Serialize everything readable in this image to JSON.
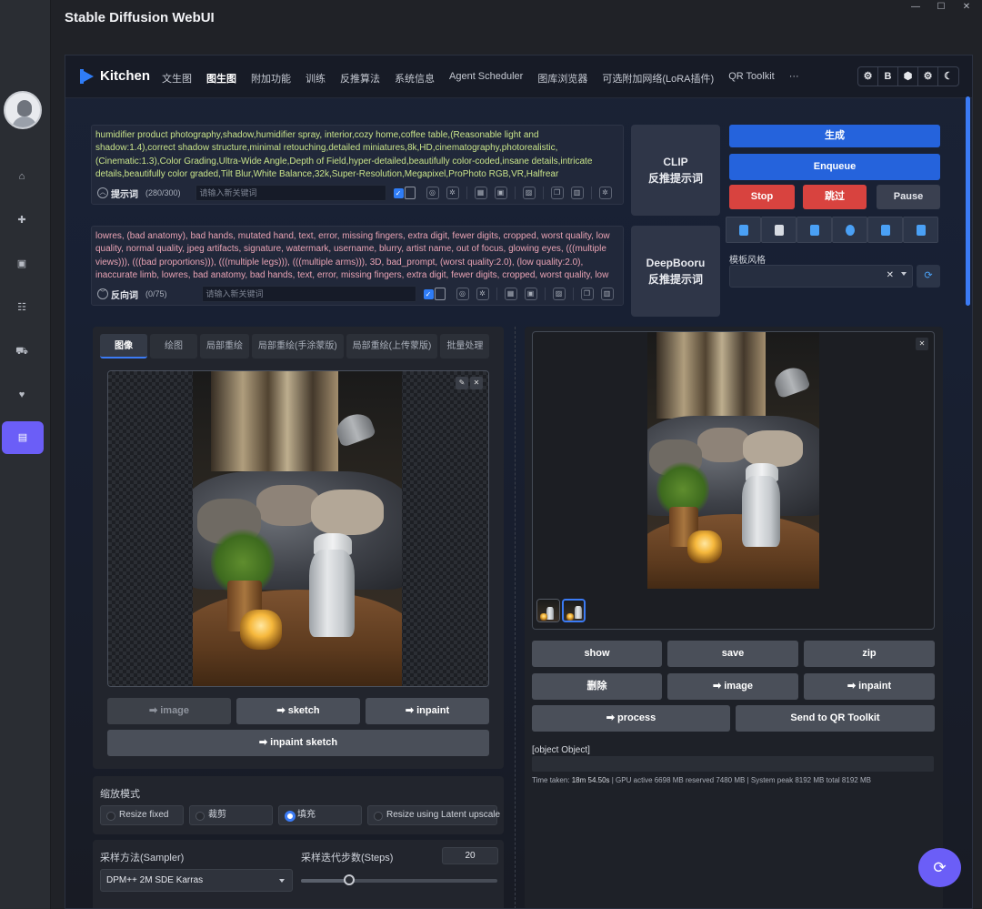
{
  "window": {
    "title": "Stable Diffusion WebUI",
    "controls": [
      "—",
      "☐",
      "✕"
    ]
  },
  "rail": {
    "items": [
      "⌂",
      "✚",
      "▣",
      "☷",
      "⛟",
      "♥",
      "▤"
    ]
  },
  "app": {
    "logo": "Kitchen",
    "tabs": [
      "文生图",
      "图生图",
      "附加功能",
      "训练",
      "反推算法",
      "系统信息",
      "Agent Scheduler",
      "图库浏览器",
      "可选附加网络(LoRA插件)",
      "QR Toolkit",
      "···"
    ],
    "active_tab": "图生图",
    "icons": [
      "⚙",
      "B",
      "⬢",
      "⚙",
      "☾"
    ]
  },
  "prompt": {
    "text": "humidifier product photography,shadow,humidifier spray, interior,cozy home,coffee table,(Reasonable light and shadow:1.4),correct shadow structure,minimal retouching,detailed miniatures,8k,HD,cinematography,photorealistic,(Cinematic:1.3),Color Grading,Ultra-Wide Angle,Depth of Field,hyper-detailed,beautifully color-coded,insane details,intricate details,beautifully color graded,Tilt Blur,White Balance,32k,Super-Resolution,Megapixel,ProPhoto RGB,VR,Halfrear",
    "label": "提示词",
    "count": "(280/300)",
    "keyword_placeholder": "请输入新关键词"
  },
  "negative": {
    "text": "lowres, (bad anatomy), bad hands, mutated hand, text, error, missing fingers, extra digit, fewer digits, cropped, worst quality, low quality, normal quality, jpeg artifacts, signature, watermark, username, blurry, artist name, out of focus, glowing eyes, (((multiple views))), (((bad proportions))), (((multiple legs))), (((multiple arms))), 3D, bad_prompt, (worst quality:2.0), (low quality:2.0), inaccurate limb, lowres, bad anatomy, bad hands, text, error, missing fingers, extra digit, fewer digits, cropped, worst quality, low",
    "label": "反向词",
    "count": "(0/75)",
    "keyword_placeholder": "请输入新关键词"
  },
  "interrogate": {
    "clip_line1": "CLIP",
    "clip_line2": "反推提示词",
    "deepbooru_line1": "DeepBooru",
    "deepbooru_line2": "反推提示词"
  },
  "actions": {
    "generate": "生成",
    "enqueue": "Enqueue",
    "stop": "Stop",
    "skip": "跳过",
    "pause": "Pause",
    "template_label": "模板风格",
    "template_clear": "✕"
  },
  "img2img": {
    "tabs": [
      "图像",
      "绘图",
      "局部重绘",
      "局部重绘(手涂蒙版)",
      "局部重绘(上传蒙版)",
      "批量处理"
    ],
    "active_tab": "图像",
    "send_buttons": [
      "➡ image",
      "➡ sketch",
      "➡ inpaint"
    ],
    "inpaint_sketch": "➡ inpaint sketch"
  },
  "resize": {
    "label": "缩放模式",
    "options": [
      "Resize fixed",
      "裁剪",
      "填充",
      "Resize using Latent upscale"
    ],
    "selected": "填充"
  },
  "sampler": {
    "label": "采样方法(Sampler)",
    "value": "DPM++ 2M SDE Karras"
  },
  "steps": {
    "label": "采样迭代步数(Steps)",
    "value": "20",
    "min": 1,
    "max": 150,
    "current": 20
  },
  "output": {
    "row1": [
      "show",
      "save",
      "zip"
    ],
    "row2": [
      "删除",
      "➡ image",
      "➡ inpaint"
    ],
    "row3": [
      "➡ process",
      "Send to QR Toolkit"
    ],
    "object_label": "[object Object]",
    "timing_prefix": "Time taken: ",
    "timing_value": "18m 54.50s",
    "timing_rest": " | GPU active 6698 MB reserved 7480 MB | System peak 8192 MB total 8192 MB"
  },
  "colors": {
    "accent": "#2563dc",
    "danger": "#d8433f",
    "fab": "#6b5ef7",
    "positive_text": "#c9e48a",
    "negative_text": "#e9a3b4"
  }
}
